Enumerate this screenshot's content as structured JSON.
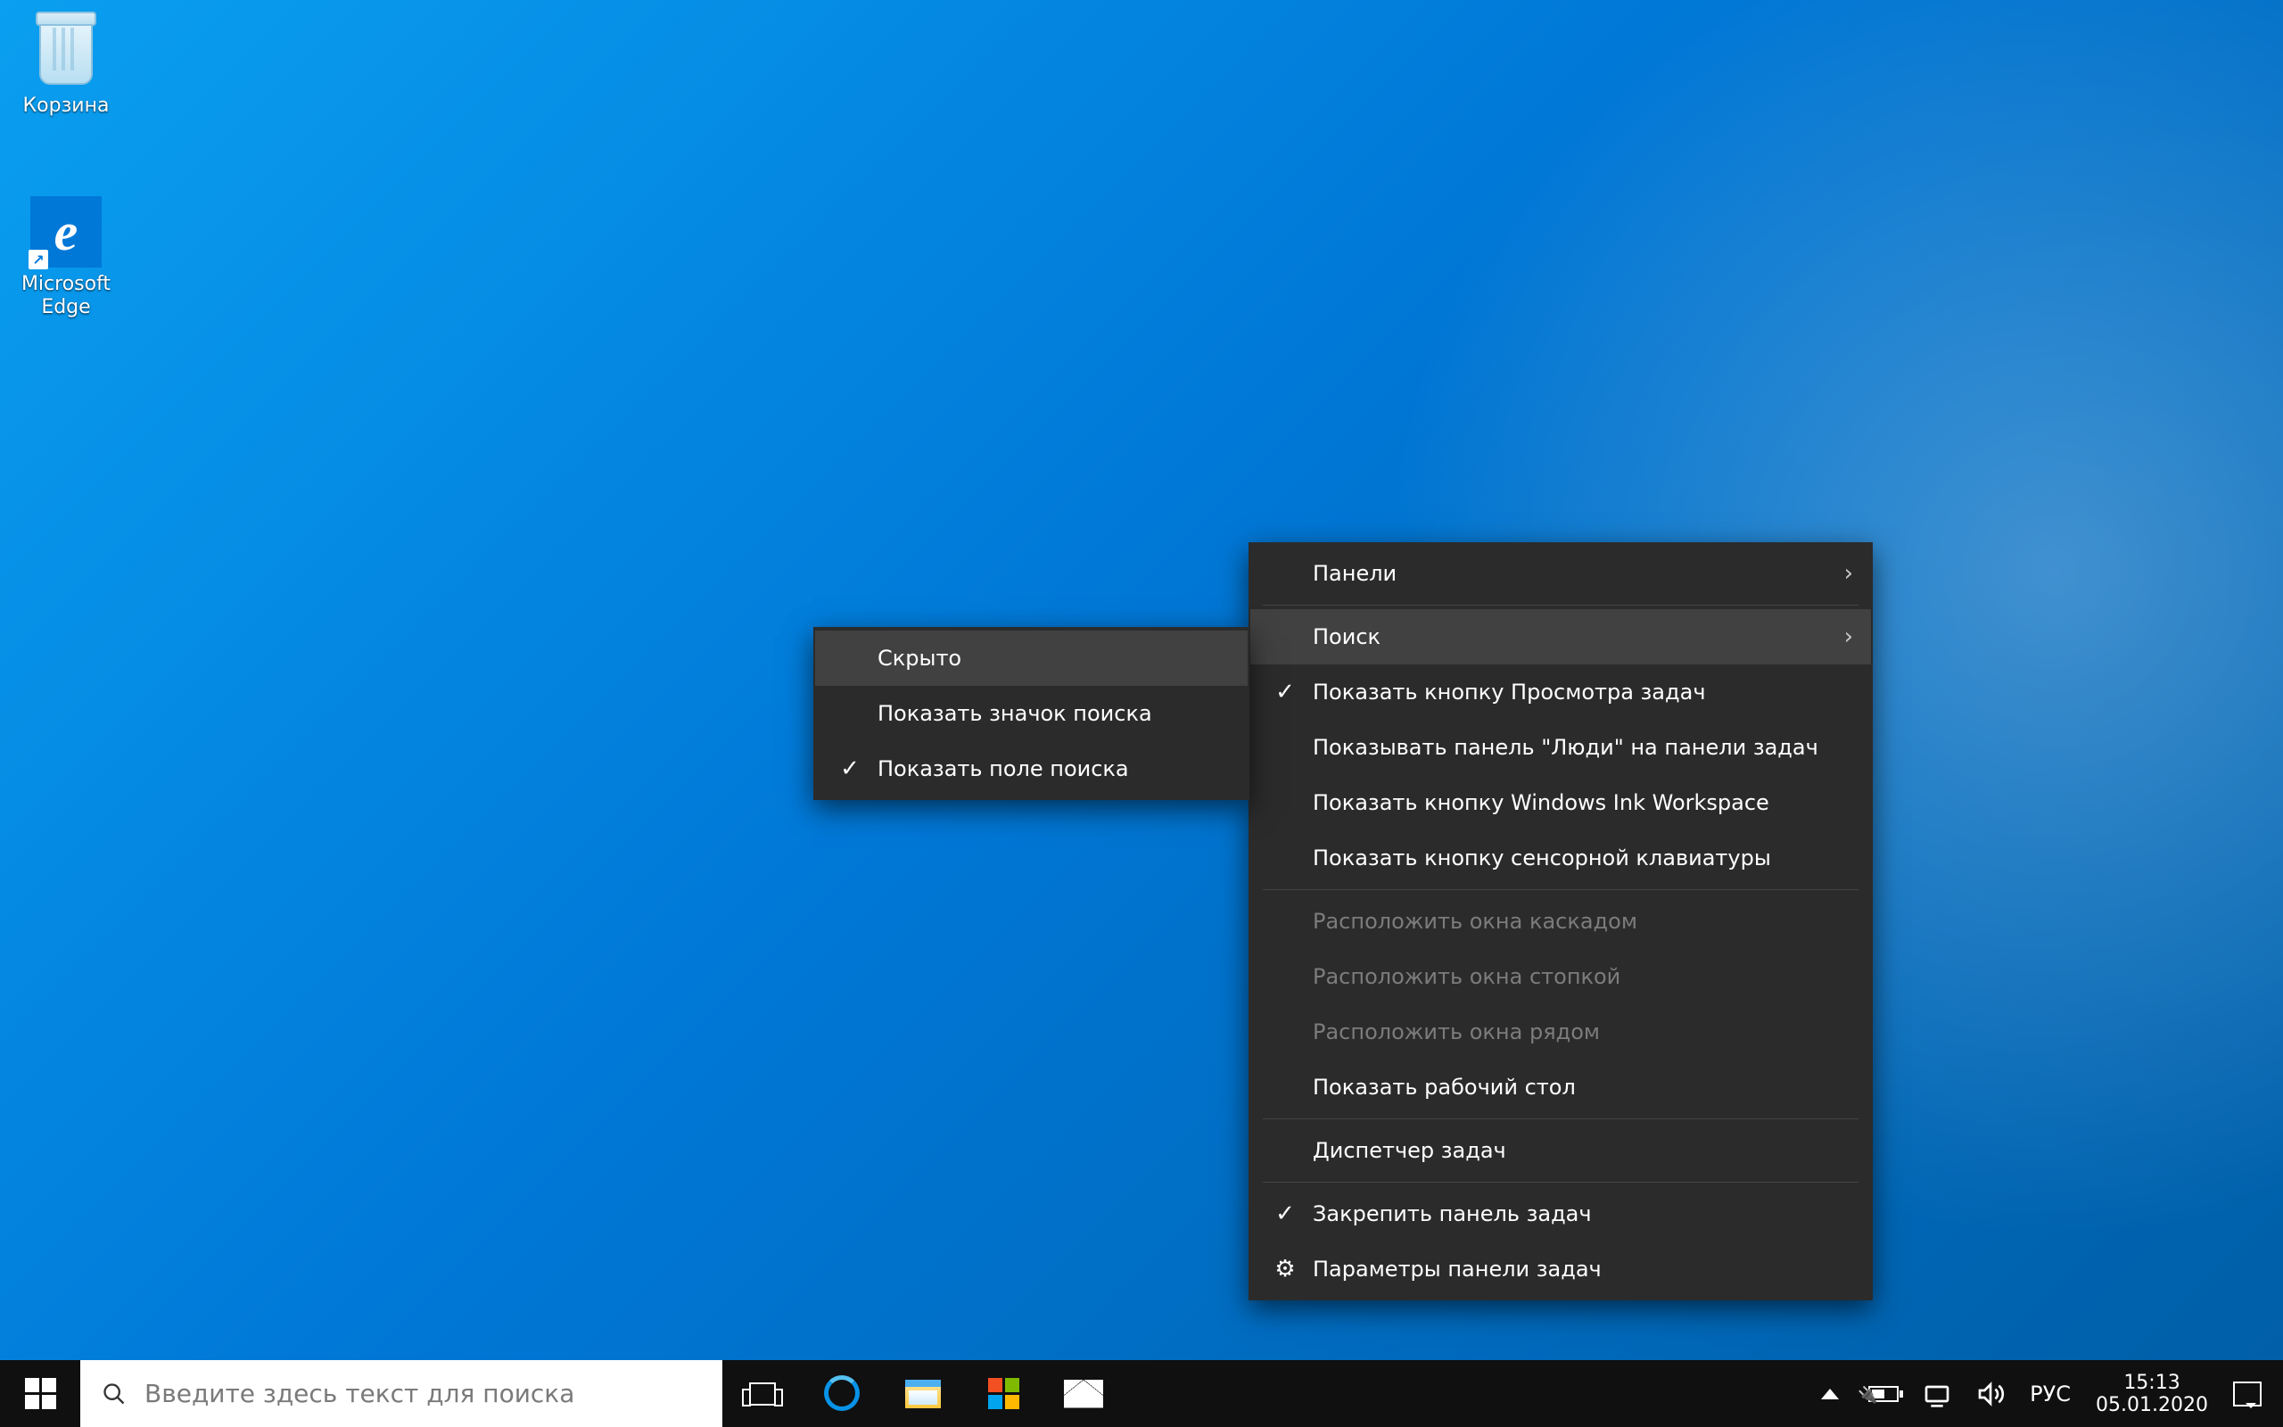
{
  "desktop": {
    "recycle_bin_label": "Корзина",
    "edge_label": "Microsoft Edge"
  },
  "taskbar": {
    "search_placeholder": "Введите здесь текст для поиска",
    "language": "РУС",
    "clock_time": "15:13",
    "clock_date": "05.01.2020"
  },
  "context_menu": {
    "toolbars": "Панели",
    "search": "Поиск",
    "show_task_view": "Показать кнопку Просмотра задач",
    "show_people": "Показывать панель \"Люди\" на панели задач",
    "show_ink": "Показать кнопку Windows Ink Workspace",
    "show_touch_kb": "Показать кнопку сенсорной клавиатуры",
    "cascade": "Расположить окна каскадом",
    "stacked": "Расположить окна стопкой",
    "side_by_side": "Расположить окна рядом",
    "show_desktop": "Показать рабочий стол",
    "task_manager": "Диспетчер задач",
    "lock_taskbar": "Закрепить панель задач",
    "taskbar_settings": "Параметры панели задач"
  },
  "search_submenu": {
    "hidden": "Скрыто",
    "show_icon": "Показать значок поиска",
    "show_box": "Показать поле поиска"
  }
}
